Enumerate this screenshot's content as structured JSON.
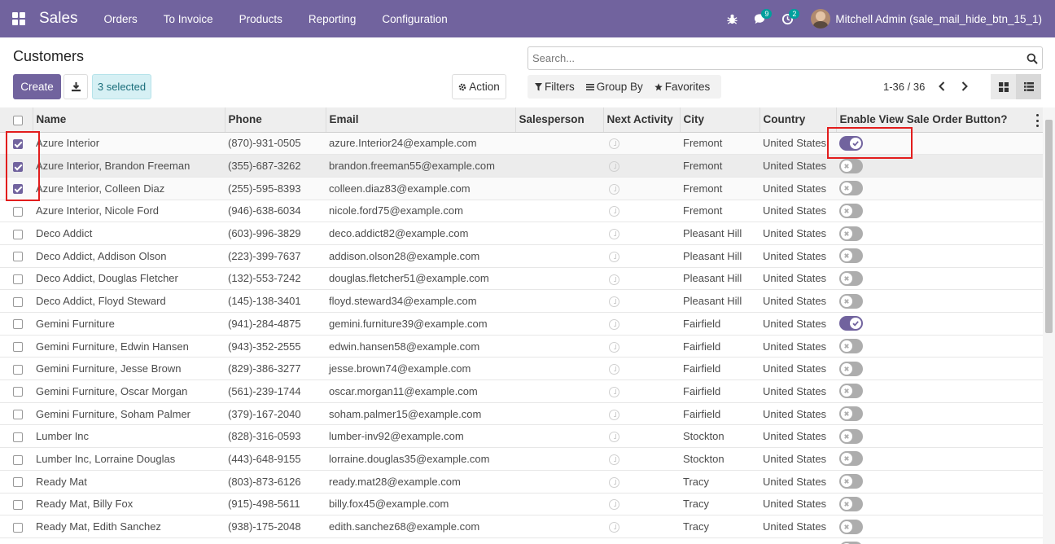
{
  "navbar": {
    "app_name": "Sales",
    "menu": [
      "Orders",
      "To Invoice",
      "Products",
      "Reporting",
      "Configuration"
    ],
    "messages_badge": "9",
    "activities_badge": "2",
    "user_name": "Mitchell Admin (sale_mail_hide_btn_15_1)",
    "bg_color": "#71639e"
  },
  "control": {
    "title": "Customers",
    "create_label": "Create",
    "selected_label": "3 selected",
    "action_label": "Action",
    "search_placeholder": "Search...",
    "filters_label": "Filters",
    "group_by_label": "Group By",
    "favorites_label": "Favorites",
    "pager": "1-36 / 36"
  },
  "table": {
    "headers": [
      "Name",
      "Phone",
      "Email",
      "Salesperson",
      "Next Activity",
      "City",
      "Country",
      "Enable View Sale Order Button?"
    ],
    "rows": [
      {
        "name": "Azure Interior",
        "phone": "(870)-931-0505",
        "email": "azure.Interior24@example.com",
        "salesperson": "",
        "city": "Fremont",
        "country": "United States",
        "enabled": true,
        "checked": true
      },
      {
        "name": "Azure Interior, Brandon Freeman",
        "phone": "(355)-687-3262",
        "email": "brandon.freeman55@example.com",
        "salesperson": "",
        "city": "Fremont",
        "country": "United States",
        "enabled": false,
        "checked": true
      },
      {
        "name": "Azure Interior, Colleen Diaz",
        "phone": "(255)-595-8393",
        "email": "colleen.diaz83@example.com",
        "salesperson": "",
        "city": "Fremont",
        "country": "United States",
        "enabled": false,
        "checked": true
      },
      {
        "name": "Azure Interior, Nicole Ford",
        "phone": "(946)-638-6034",
        "email": "nicole.ford75@example.com",
        "salesperson": "",
        "city": "Fremont",
        "country": "United States",
        "enabled": false,
        "checked": false
      },
      {
        "name": "Deco Addict",
        "phone": "(603)-996-3829",
        "email": "deco.addict82@example.com",
        "salesperson": "",
        "city": "Pleasant Hill",
        "country": "United States",
        "enabled": false,
        "checked": false
      },
      {
        "name": "Deco Addict, Addison Olson",
        "phone": "(223)-399-7637",
        "email": "addison.olson28@example.com",
        "salesperson": "",
        "city": "Pleasant Hill",
        "country": "United States",
        "enabled": false,
        "checked": false
      },
      {
        "name": "Deco Addict, Douglas Fletcher",
        "phone": "(132)-553-7242",
        "email": "douglas.fletcher51@example.com",
        "salesperson": "",
        "city": "Pleasant Hill",
        "country": "United States",
        "enabled": false,
        "checked": false
      },
      {
        "name": "Deco Addict, Floyd Steward",
        "phone": "(145)-138-3401",
        "email": "floyd.steward34@example.com",
        "salesperson": "",
        "city": "Pleasant Hill",
        "country": "United States",
        "enabled": false,
        "checked": false
      },
      {
        "name": "Gemini Furniture",
        "phone": "(941)-284-4875",
        "email": "gemini.furniture39@example.com",
        "salesperson": "",
        "city": "Fairfield",
        "country": "United States",
        "enabled": true,
        "checked": false
      },
      {
        "name": "Gemini Furniture, Edwin Hansen",
        "phone": "(943)-352-2555",
        "email": "edwin.hansen58@example.com",
        "salesperson": "",
        "city": "Fairfield",
        "country": "United States",
        "enabled": false,
        "checked": false
      },
      {
        "name": "Gemini Furniture, Jesse Brown",
        "phone": "(829)-386-3277",
        "email": "jesse.brown74@example.com",
        "salesperson": "",
        "city": "Fairfield",
        "country": "United States",
        "enabled": false,
        "checked": false
      },
      {
        "name": "Gemini Furniture, Oscar Morgan",
        "phone": "(561)-239-1744",
        "email": "oscar.morgan11@example.com",
        "salesperson": "",
        "city": "Fairfield",
        "country": "United States",
        "enabled": false,
        "checked": false
      },
      {
        "name": "Gemini Furniture, Soham Palmer",
        "phone": "(379)-167-2040",
        "email": "soham.palmer15@example.com",
        "salesperson": "",
        "city": "Fairfield",
        "country": "United States",
        "enabled": false,
        "checked": false
      },
      {
        "name": "Lumber Inc",
        "phone": "(828)-316-0593",
        "email": "lumber-inv92@example.com",
        "salesperson": "",
        "city": "Stockton",
        "country": "United States",
        "enabled": false,
        "checked": false
      },
      {
        "name": "Lumber Inc, Lorraine Douglas",
        "phone": "(443)-648-9155",
        "email": "lorraine.douglas35@example.com",
        "salesperson": "",
        "city": "Stockton",
        "country": "United States",
        "enabled": false,
        "checked": false
      },
      {
        "name": "Ready Mat",
        "phone": "(803)-873-6126",
        "email": "ready.mat28@example.com",
        "salesperson": "",
        "city": "Tracy",
        "country": "United States",
        "enabled": false,
        "checked": false
      },
      {
        "name": "Ready Mat, Billy Fox",
        "phone": "(915)-498-5611",
        "email": "billy.fox45@example.com",
        "salesperson": "",
        "city": "Tracy",
        "country": "United States",
        "enabled": false,
        "checked": false
      },
      {
        "name": "Ready Mat, Edith Sanchez",
        "phone": "(938)-175-2048",
        "email": "edith.sanchez68@example.com",
        "salesperson": "",
        "city": "Tracy",
        "country": "United States",
        "enabled": false,
        "checked": false
      },
      {
        "name": "",
        "phone": "",
        "email": "",
        "salesperson": "",
        "city": "",
        "country": "",
        "enabled": false,
        "checked": false
      }
    ]
  }
}
